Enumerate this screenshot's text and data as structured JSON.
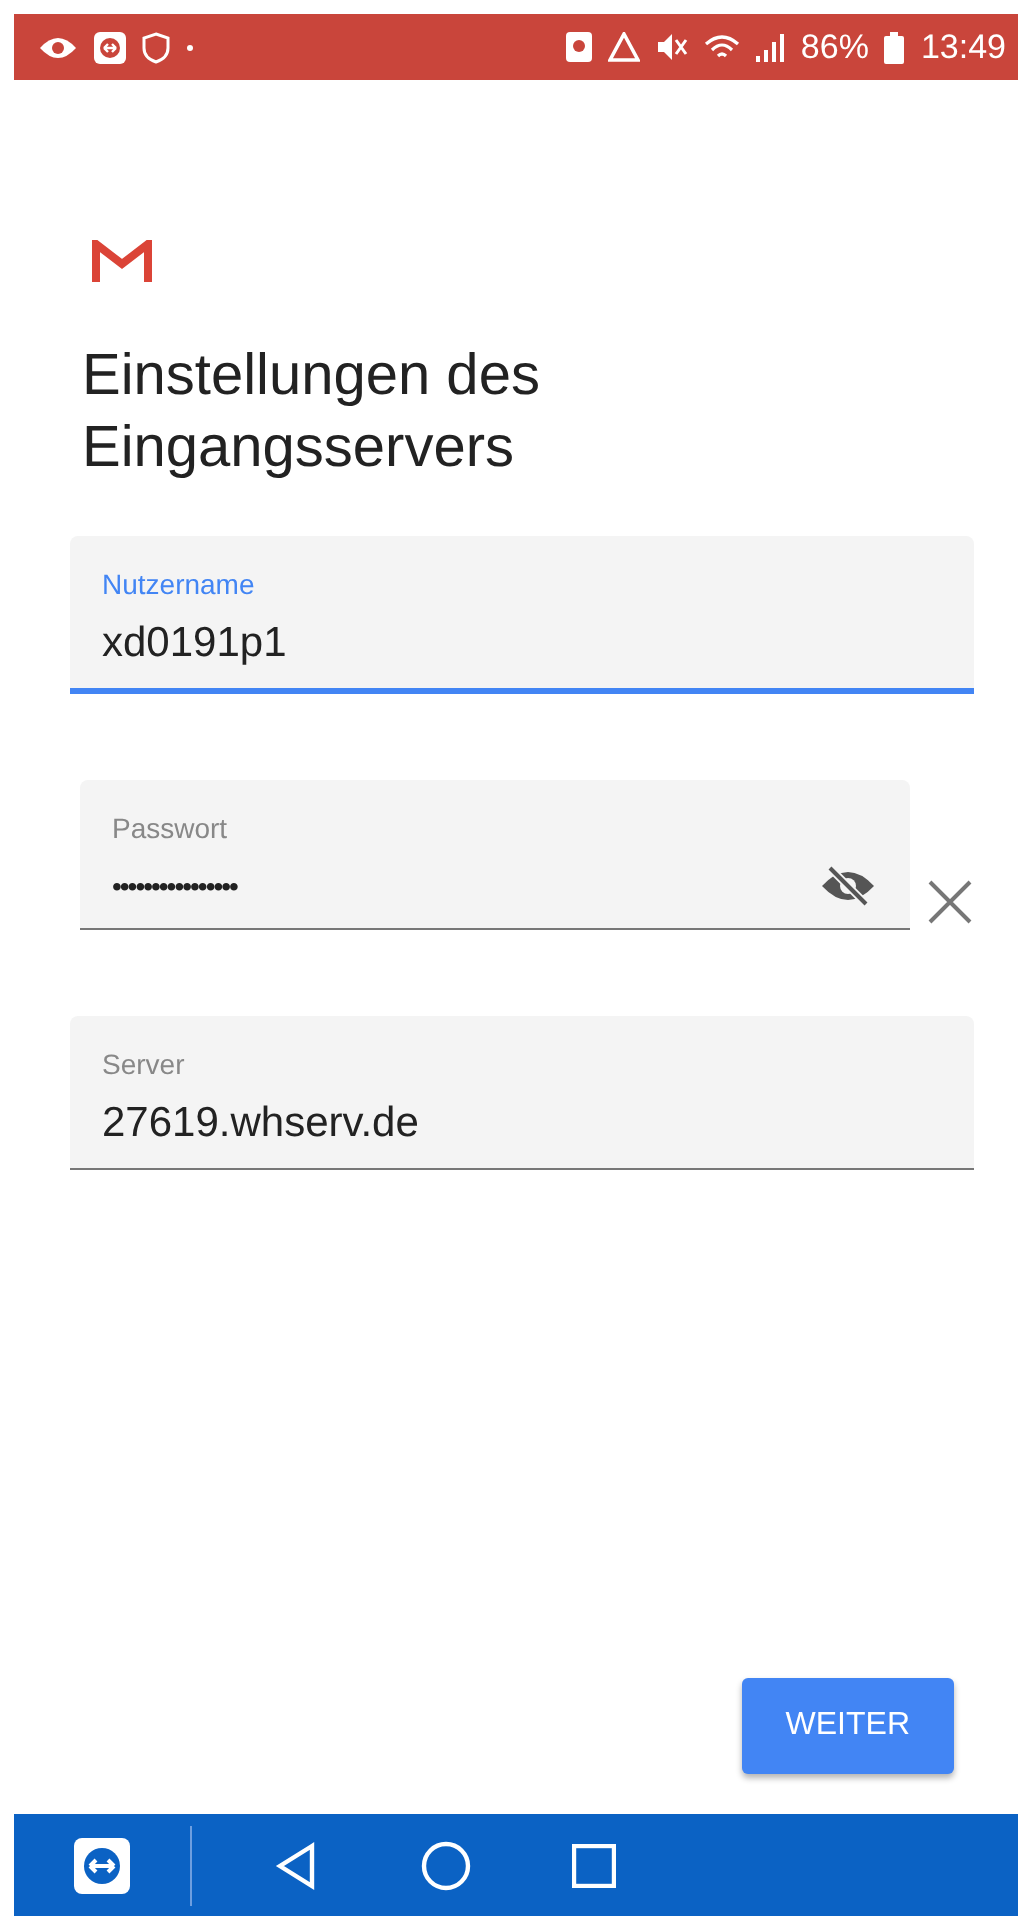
{
  "status_bar": {
    "battery": "86%",
    "time": "13:49"
  },
  "title": "Einstellungen des Eingangsservers",
  "fields": [
    {
      "kind": "text",
      "label": "Nutzername",
      "value": "xd0191p1",
      "focused": true
    },
    {
      "kind": "password",
      "label": "Passwort",
      "value": "••••••••••••••••",
      "focused": false
    },
    {
      "kind": "text",
      "label": "Server",
      "value": "27619.whserv.de",
      "focused": false
    }
  ],
  "buttons": [
    "WEITER"
  ]
}
